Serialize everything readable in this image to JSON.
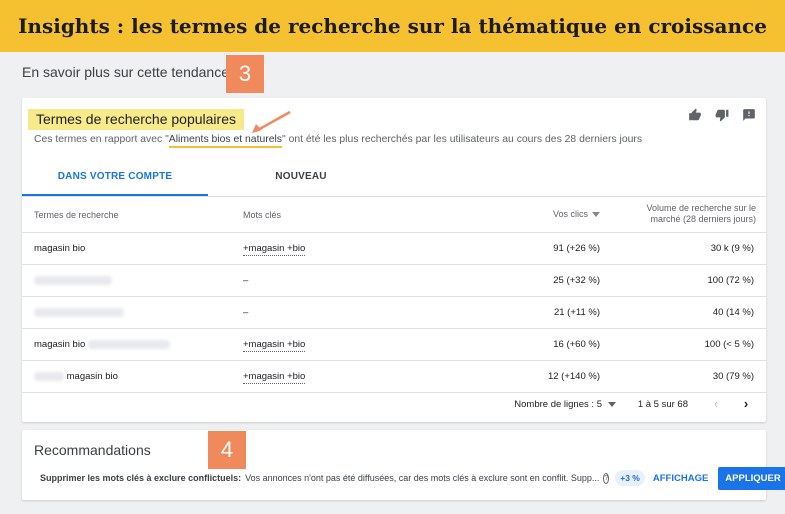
{
  "banner": {
    "title": "Insights : les termes de recherche sur la thématique en croissance"
  },
  "sub_heading": "En savoir plus sur cette tendance",
  "badges": {
    "step3": "3",
    "step4": "4"
  },
  "card": {
    "title": "Termes de recherche populaires",
    "description_pre": "Ces termes en rapport avec \"",
    "description_highlight": "Aliments bios et naturels",
    "description_post": "\" ont été les plus recherchés par les utilisateurs au cours des 28 derniers jours",
    "actions": [
      "thumb-up-icon",
      "thumb-down-icon",
      "feedback-icon"
    ],
    "tabs": [
      {
        "label": "DANS VOTRE COMPTE",
        "active": true
      },
      {
        "label": "NOUVEAU",
        "active": false
      }
    ],
    "columns": {
      "term": "Termes de recherche",
      "keywords": "Mots clés",
      "clicks": "Vos clics",
      "volume": "Volume de recherche sur le marché (28 derniers jours)"
    },
    "rows": [
      {
        "term": "magasin bio",
        "keywords": "+magasin +bio",
        "clicks": "91 (+26 %)",
        "volume": "30 k (9 %)"
      },
      {
        "term": "",
        "keywords": "–",
        "clicks": "25 (+32 %)",
        "volume": "100 (72 %)"
      },
      {
        "term": "",
        "keywords": "–",
        "clicks": "21 (+11 %)",
        "volume": "40 (14 %)"
      },
      {
        "term": "magasin bio",
        "keywords": "+magasin +bio",
        "clicks": "16 (+60 %)",
        "volume": "100 (< 5 %)"
      },
      {
        "term": "magasin bio",
        "keywords": "+magasin +bio",
        "clicks": "12 (+140 %)",
        "volume": "30 (79 %)"
      }
    ],
    "pager": {
      "rows_label": "Nombre de lignes :",
      "rows_value": "5",
      "range": "1 à 5 sur 68",
      "prev": "‹",
      "next": "›"
    }
  },
  "recommendations": {
    "title": "Recommandations",
    "item_title": "Supprimer les mots clés à exclure conflictuels:",
    "item_text": "Vos annonces n'ont pas été diffusées, car des mots clés à exclure sont en conflit. Supp...",
    "help": "?",
    "chip": "+3 %",
    "view_label": "AFFICHAGE",
    "apply_label": "APPLIQUER"
  },
  "colors": {
    "banner": "#f5c130",
    "accent": "#1a73e8",
    "badge": "#f08a5d",
    "highlight": "#f7ea8a"
  }
}
